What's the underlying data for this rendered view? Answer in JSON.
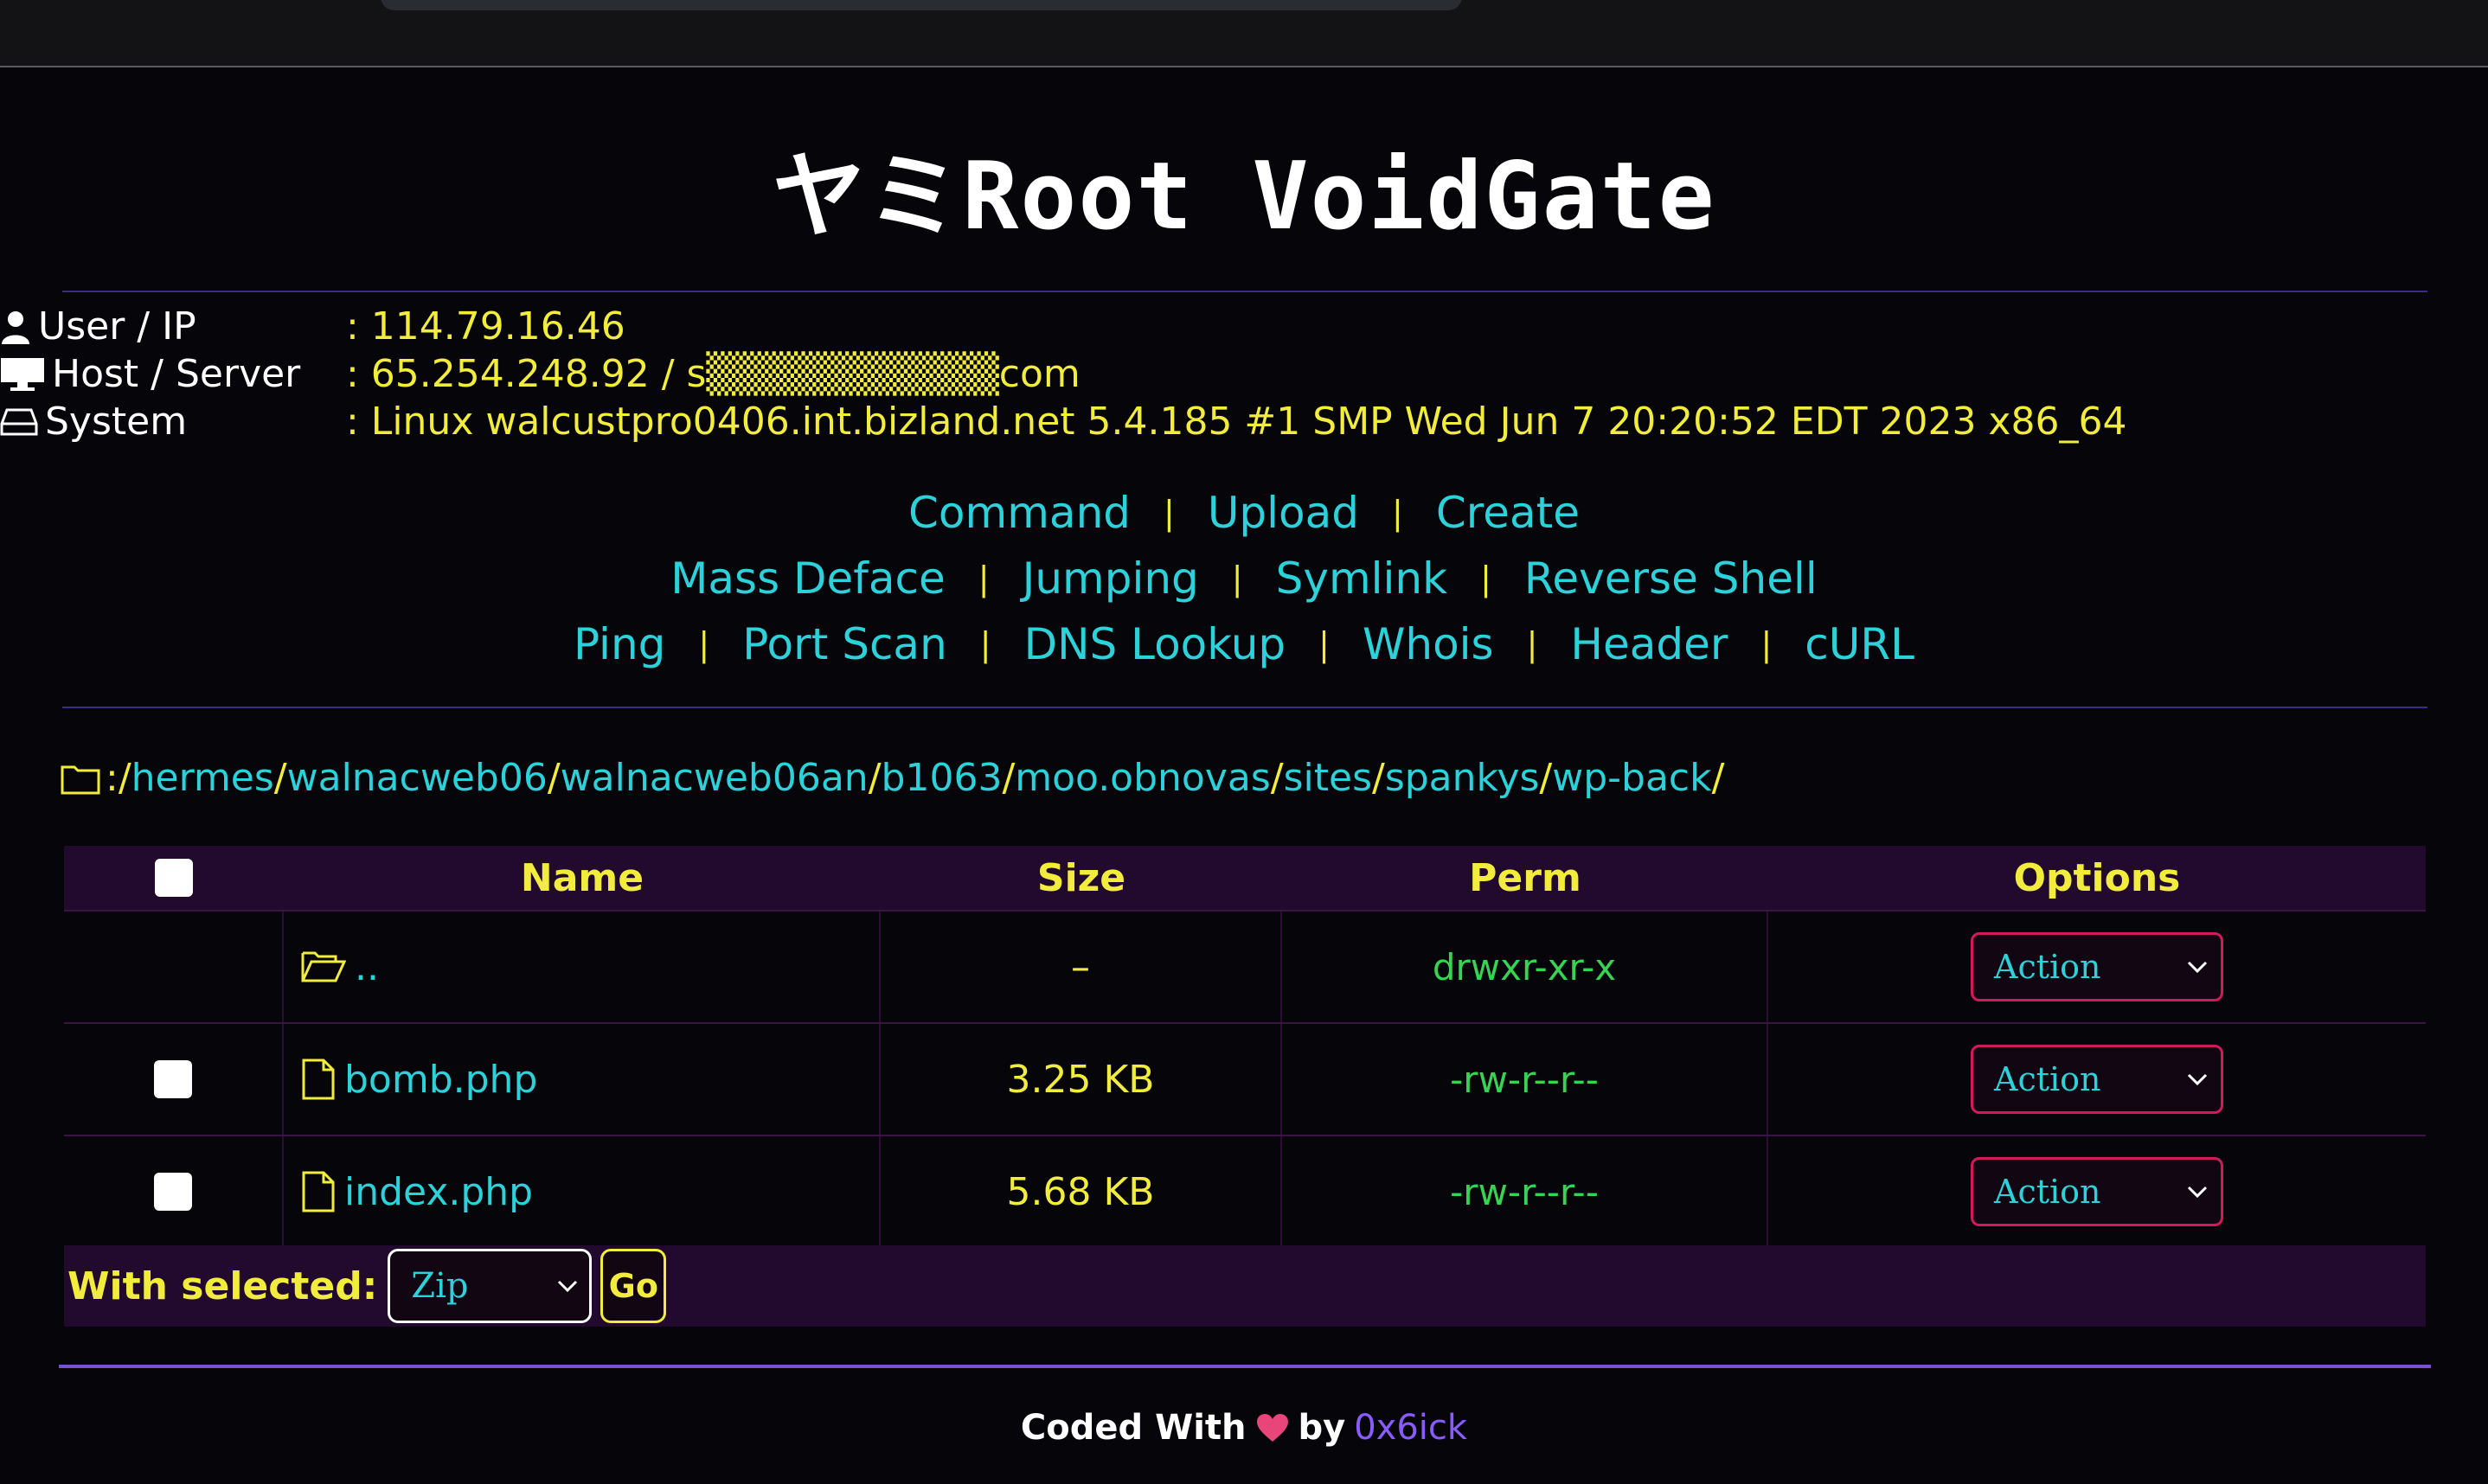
{
  "title": "ヤミRoot VoidGate",
  "info": [
    {
      "icon": "user-icon",
      "label": "User / IP",
      "value": ": 114.79.16.46"
    },
    {
      "icon": "monitor-icon",
      "label": "Host / Server",
      "value": ": 65.254.248.92 / s▒▒▒▒▒▒▒▒▒▒com"
    },
    {
      "icon": "drive-icon",
      "label": "System",
      "value": ": Linux walcustpro0406.int.bizland.net 5.4.185 #1 SMP Wed Jun 7 20:20:52 EDT 2023 x86_64"
    }
  ],
  "nav": {
    "line1": [
      "Command",
      "Upload",
      "Create"
    ],
    "line2": [
      "Mass Deface",
      "Jumping",
      "Symlink",
      "Reverse Shell"
    ],
    "line3": [
      "Ping",
      "Port Scan",
      "DNS Lookup",
      "Whois",
      "Header",
      "cURL"
    ],
    "separator": "|"
  },
  "path": {
    "prefix": ": ",
    "segments": [
      "hermes",
      "walnacweb06",
      "walnacweb06an",
      "b1063",
      "moo.obnovas",
      "sites",
      "spankys",
      "wp-back"
    ],
    "sep": "/"
  },
  "table": {
    "headers": {
      "name": "Name",
      "size": "Size",
      "perm": "Perm",
      "options": "Options"
    },
    "rows": [
      {
        "type": "parent",
        "name": "..",
        "size": "–",
        "perm": "drwxr-xr-x",
        "action": "Action"
      },
      {
        "type": "file",
        "name": "bomb.php",
        "size": "3.25 KB",
        "perm": "-rw-r--r--",
        "action": "Action"
      },
      {
        "type": "file",
        "name": "index.php",
        "size": "5.68 KB",
        "perm": "-rw-r--r--",
        "action": "Action"
      }
    ]
  },
  "bulk": {
    "label": "With selected:",
    "option": "Zip",
    "go": "Go"
  },
  "footer": {
    "prefix": "Coded With",
    "by": "by",
    "author": "0x6ick"
  },
  "colors": {
    "accent_yellow": "#f2ec3d",
    "accent_cyan": "#2dd1d9",
    "perm_green": "#39d353",
    "select_border": "#d21a5a",
    "author_purple": "#8a5cff"
  }
}
